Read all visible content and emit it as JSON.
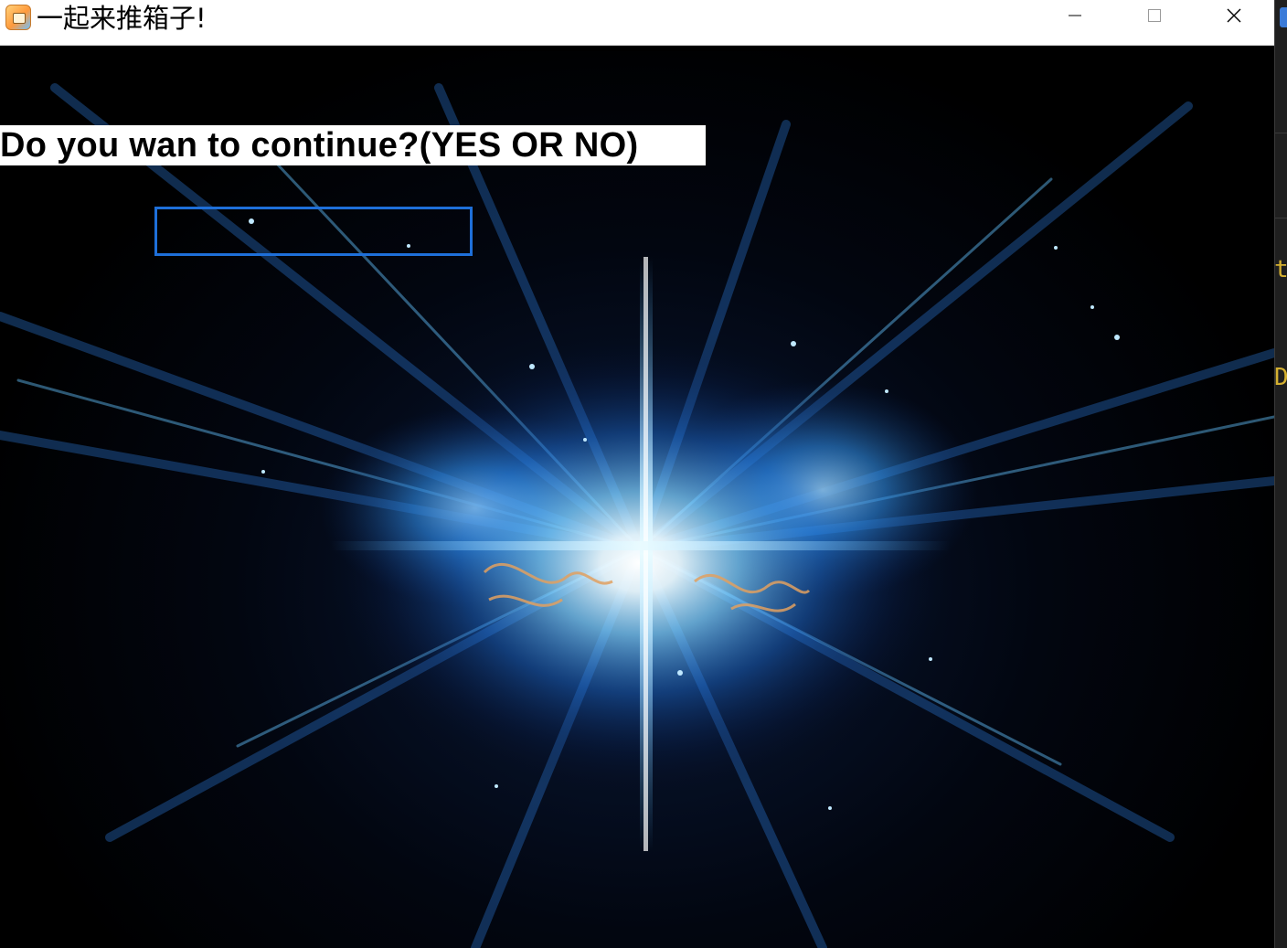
{
  "window": {
    "title": "一起来推箱子!",
    "icon": "game-app-icon",
    "controls": {
      "minimize": "minimize-icon",
      "maximize": "maximize-icon",
      "close": "close-icon"
    }
  },
  "game": {
    "prompt": "Do you wan to continue?(YES OR NO)",
    "answer_value": "",
    "background": "blue-explosion-burst",
    "input_border_color": "#1e6fd9",
    "burst_color": "#4fb6ff"
  },
  "side_panel": {
    "fragments": [
      "th",
      "D,"
    ],
    "accent_color": "#3b7bd8",
    "text_color": "#d4b030"
  }
}
